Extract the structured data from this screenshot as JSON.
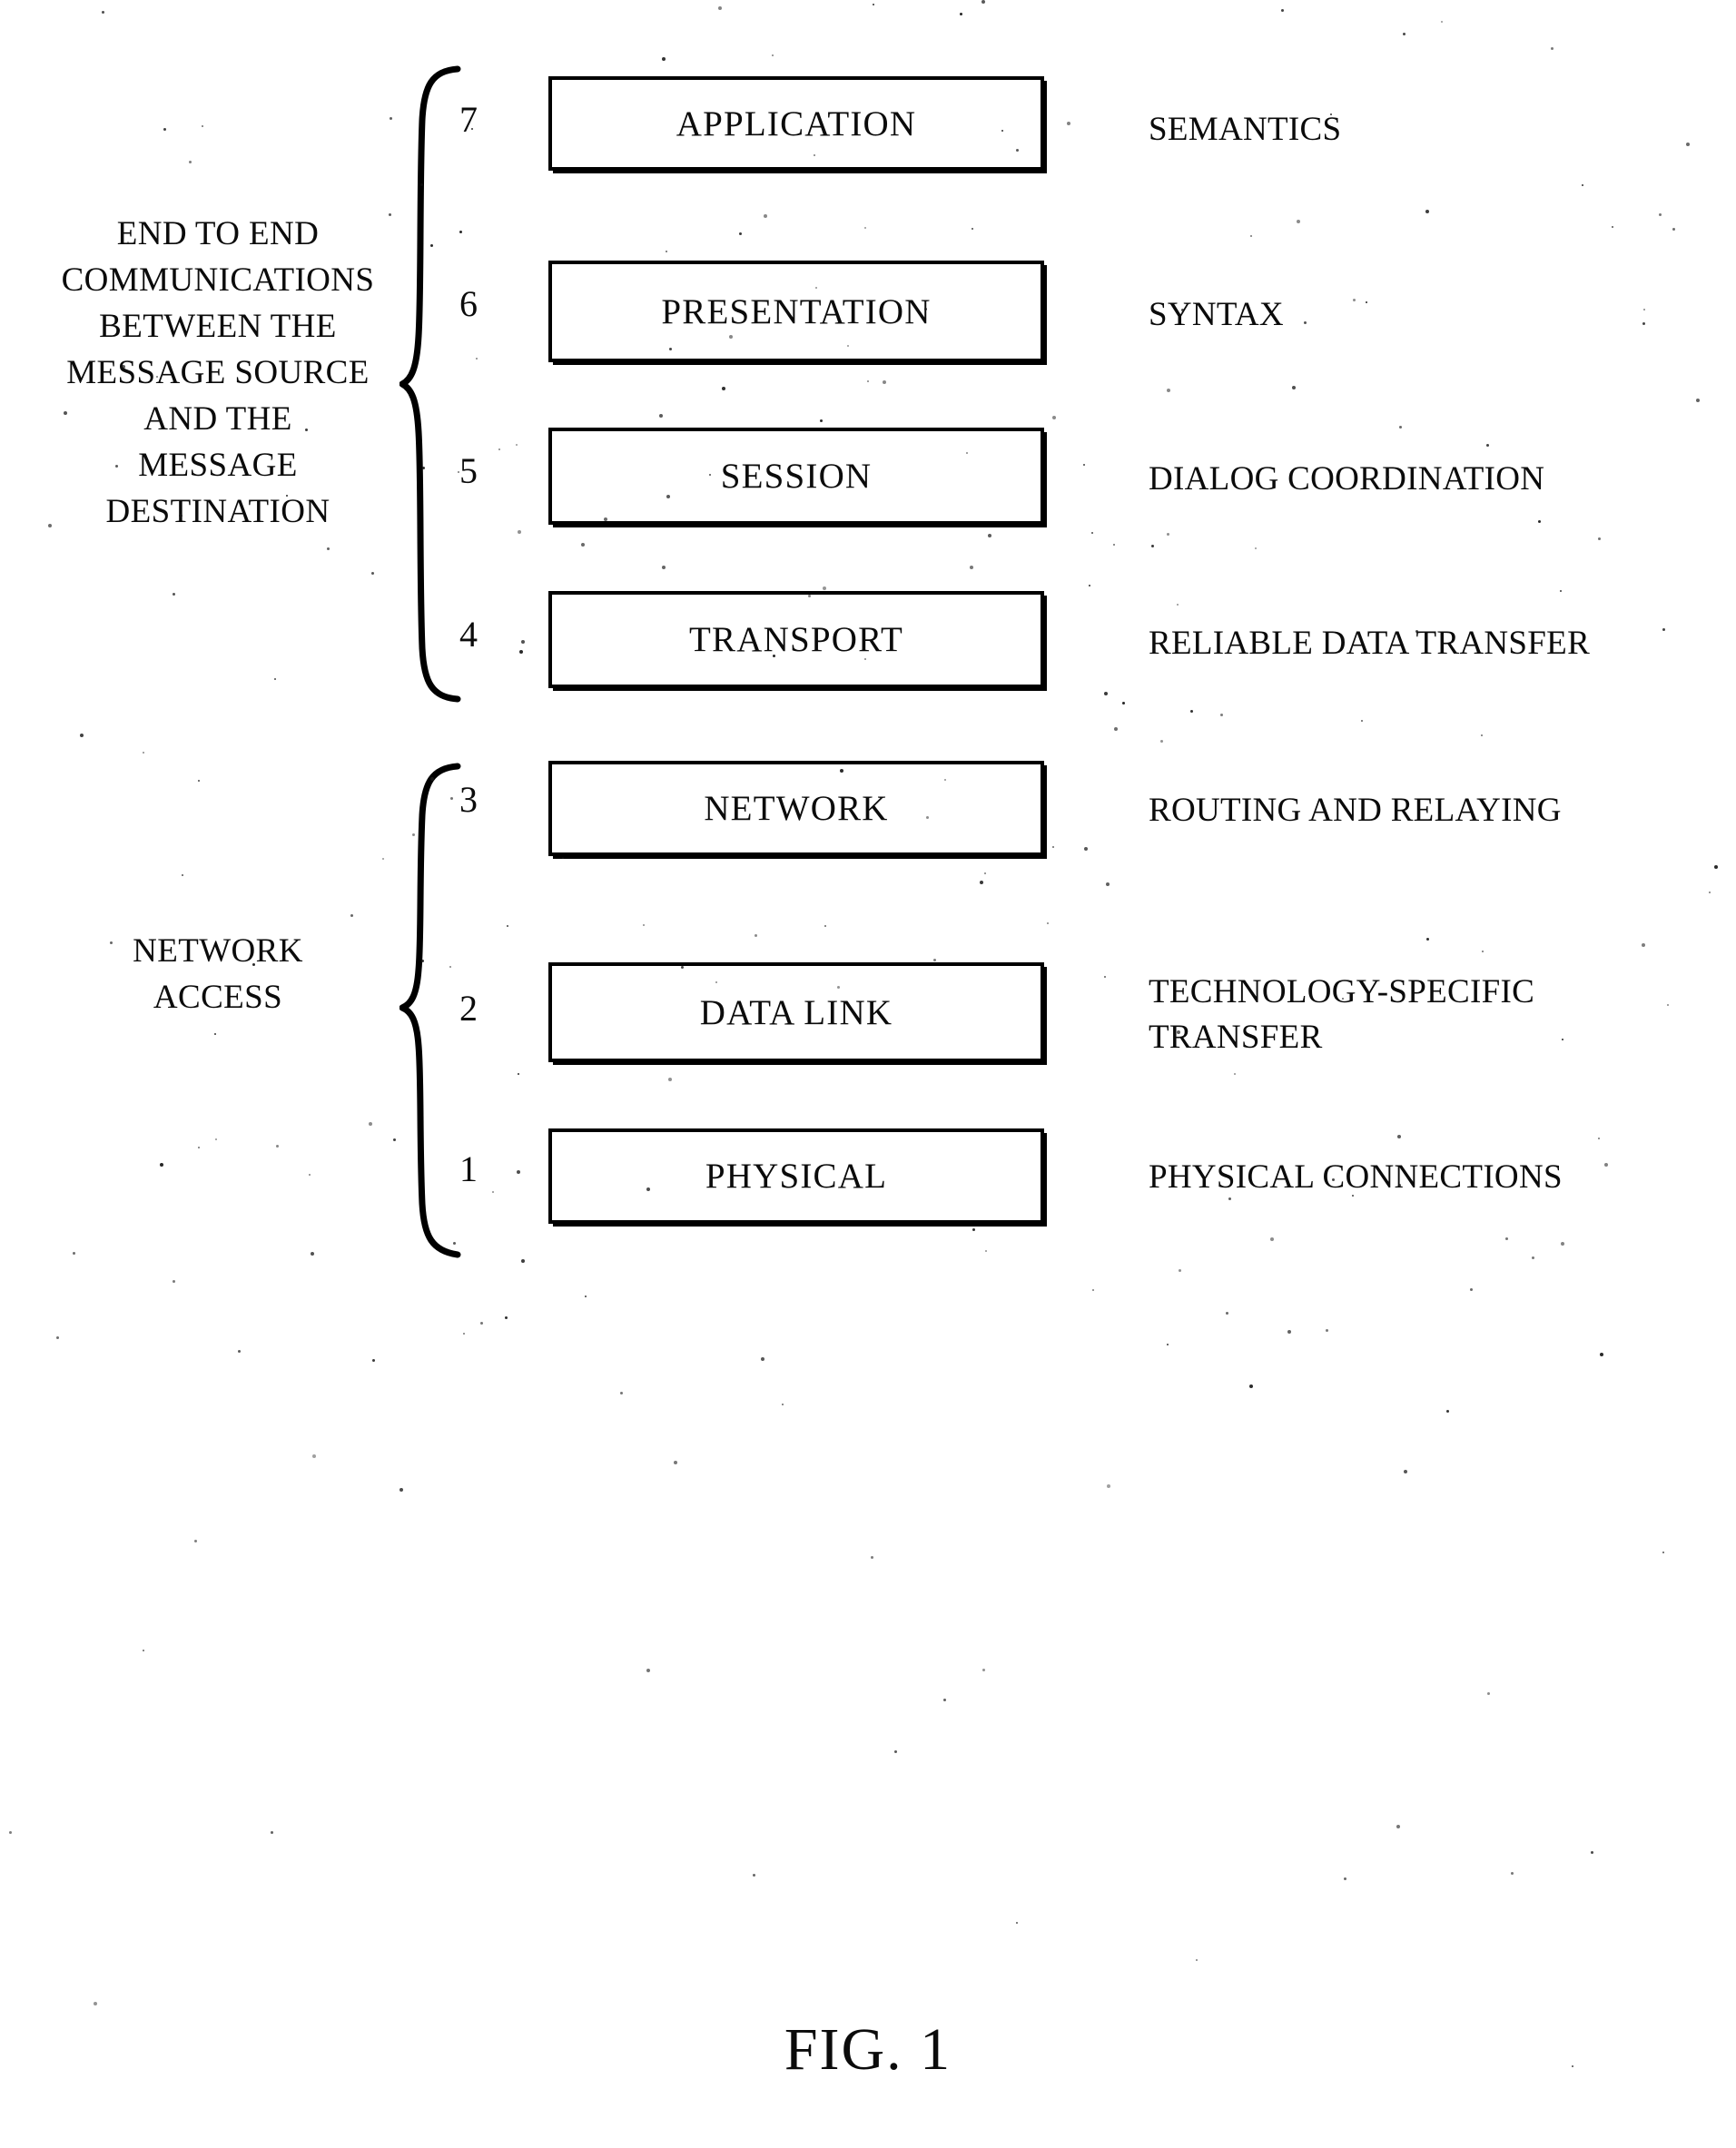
{
  "figure": {
    "caption": "FIG. 1",
    "groups": [
      {
        "id": "end-to-end",
        "label": "END TO END\nCOMMUNICATIONS\nBETWEEN THE\nMESSAGE SOURCE\nAND THE\nMESSAGE\nDESTINATION"
      },
      {
        "id": "network-access",
        "label": "NETWORK\nACCESS"
      }
    ],
    "layers": [
      {
        "number": "7",
        "name": "APPLICATION",
        "description": "SEMANTICS"
      },
      {
        "number": "6",
        "name": "PRESENTATION",
        "description": "SYNTAX"
      },
      {
        "number": "5",
        "name": "SESSION",
        "description": "DIALOG COORDINATION"
      },
      {
        "number": "4",
        "name": "TRANSPORT",
        "description": "RELIABLE DATA TRANSFER"
      },
      {
        "number": "3",
        "name": "NETWORK",
        "description": "ROUTING AND RELAYING"
      },
      {
        "number": "2",
        "name": "DATA LINK",
        "description": "TECHNOLOGY-SPECIFIC TRANSFER"
      },
      {
        "number": "1",
        "name": "PHYSICAL",
        "description": "PHYSICAL CONNECTIONS"
      }
    ],
    "colors": {
      "ink": "#000000",
      "paper": "#ffffff"
    }
  }
}
